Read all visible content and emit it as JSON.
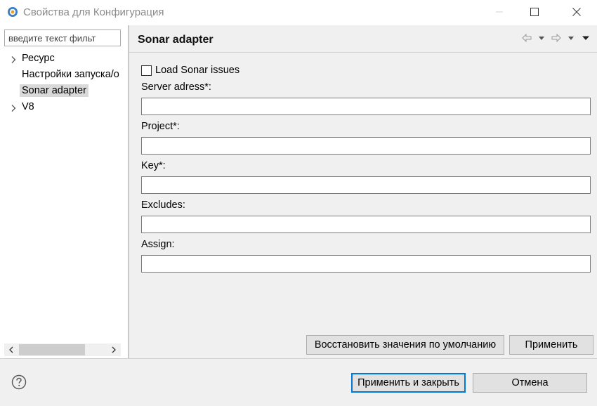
{
  "window": {
    "title": "Свойства для Конфигурация",
    "icon": "eclipse-app-icon",
    "controls": [
      "minimize-icon",
      "maximize-icon",
      "close-icon"
    ]
  },
  "sidebar": {
    "filter_placeholder": "введите текст фильт",
    "items": [
      {
        "label": "Ресурс",
        "expandable": true,
        "selected": false
      },
      {
        "label": "Настройки запуска/о",
        "expandable": false,
        "selected": false
      },
      {
        "label": "Sonar adapter",
        "expandable": false,
        "selected": true
      },
      {
        "label": "V8",
        "expandable": true,
        "selected": false
      }
    ]
  },
  "page": {
    "title": "Sonar adapter",
    "nav_icons": [
      "back-arrow-icon",
      "back-dropdown-icon",
      "forward-arrow-icon",
      "forward-dropdown-icon",
      "view-menu-icon"
    ],
    "checkbox": {
      "label": "Load Sonar issues",
      "checked": false
    },
    "fields": [
      {
        "label": "Server adress*:",
        "value": ""
      },
      {
        "label": "Project*:",
        "value": ""
      },
      {
        "label": "Key*:",
        "value": ""
      },
      {
        "label": "Excludes:",
        "value": ""
      },
      {
        "label": "Assign:",
        "value": ""
      }
    ],
    "restore_defaults_label": "Восстановить значения по умолчанию",
    "apply_label": "Применить"
  },
  "footer": {
    "help_icon": "help-icon",
    "apply_close_label": "Применить и закрыть",
    "cancel_label": "Отмена"
  },
  "colors": {
    "window_bg": "#f0f0f0",
    "tree_bg": "#ffffff",
    "selection": "#d9d9d9",
    "button_bg": "#e1e1e1",
    "focus_border": "#0078d7"
  }
}
